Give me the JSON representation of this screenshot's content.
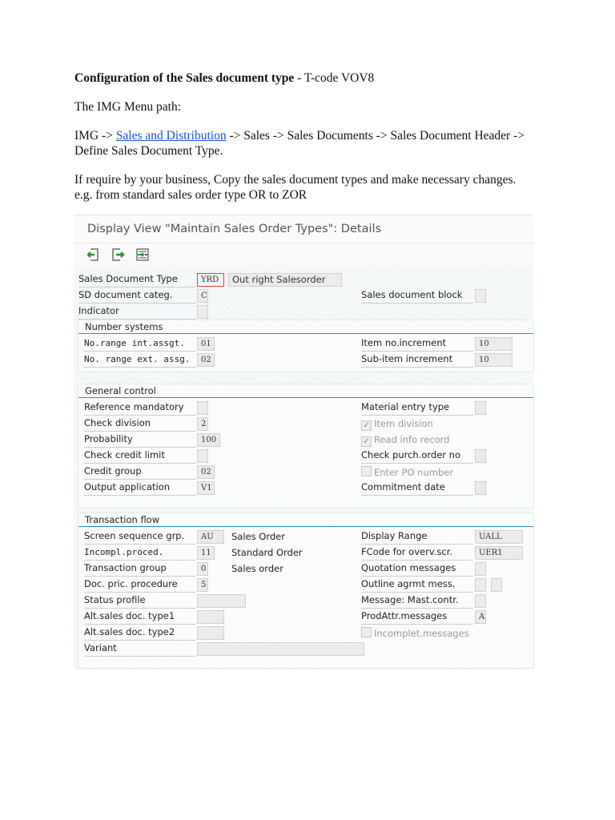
{
  "doc": {
    "heading_bold": "Configuration of the Sales document type",
    "heading_rest": " - T-code VOV8",
    "img_path_label": "The IMG Menu path:",
    "path_prefix": "IMG -> ",
    "path_link": "Sales and Distribution",
    "path_rest": " -> Sales -> Sales Documents -> Sales Document Header -> Define Sales Document Type.",
    "copy_note": "If require by your business, Copy the sales document types and make necessary changes.  e.g. from standard sales order type OR to ZOR"
  },
  "sap": {
    "title": "Display View \"Maintain Sales Order Types\": Details",
    "toolbar": [
      "previous-entry-icon",
      "next-entry-icon",
      "select-block-icon"
    ],
    "sections": [
      {
        "id": "header",
        "title": null,
        "rows": [
          {
            "left": {
              "label": "Sales Document Type",
              "value": "YRD",
              "desc": "Out right Salesorder"
            },
            "right": null
          },
          {
            "left": {
              "label": "SD document categ.",
              "value": "C"
            },
            "right": {
              "label": "Sales document block",
              "value": ""
            }
          },
          {
            "left": {
              "label": "Indicator",
              "value": ""
            },
            "right": null
          }
        ]
      },
      {
        "id": "number-systems",
        "title": "Number systems",
        "rows": [
          {
            "left": {
              "label": "No.range int.assgt.",
              "value": "01",
              "mono": true
            },
            "right": {
              "label": "Item no.increment",
              "value": "10"
            }
          },
          {
            "left": {
              "label": "No. range ext. assg.",
              "value": "02",
              "mono": true
            },
            "right": {
              "label": "Sub-item increment",
              "value": "10"
            }
          }
        ]
      },
      {
        "id": "general-control",
        "title": "General control",
        "rows": [
          {
            "left": {
              "label": "Reference mandatory",
              "value": ""
            },
            "right": {
              "label": "Material entry type",
              "value": ""
            }
          },
          {
            "left": {
              "label": "Check division",
              "value": "2"
            },
            "right": {
              "checkbox": "Item division",
              "checked": true
            }
          },
          {
            "left": {
              "label": "Probability",
              "value": "100"
            },
            "right": {
              "checkbox": "Read info record",
              "checked": true
            }
          },
          {
            "left": {
              "label": "Check credit limit",
              "value": ""
            },
            "right": {
              "label": "Check purch.order no",
              "value": ""
            }
          },
          {
            "left": {
              "label": "Credit group",
              "value": "02"
            },
            "right": {
              "checkbox": "Enter PO number",
              "checked": false
            }
          },
          {
            "left": {
              "label": "Output application",
              "value": "V1"
            },
            "right": {
              "label": "Commitment  date",
              "value": ""
            }
          }
        ]
      },
      {
        "id": "transaction-flow",
        "title": "Transaction flow",
        "rows": [
          {
            "left": {
              "label": "Screen sequence grp.",
              "value": "AU",
              "desc": "Sales Order"
            },
            "right": {
              "label": "Display Range",
              "value": "UALL"
            }
          },
          {
            "left": {
              "label": "Incompl.proced.",
              "value": "11",
              "desc": "Standard Order",
              "mono": true
            },
            "right": {
              "label": "FCode for overv.scr.",
              "value": "UER1"
            }
          },
          {
            "left": {
              "label": "Transaction group",
              "value": "0",
              "desc": "Sales order"
            },
            "right": {
              "label": "Quotation messages",
              "value": ""
            }
          },
          {
            "left": {
              "label": "Doc. pric. procedure",
              "value": "5"
            },
            "right": {
              "label": "Outline agrmt mess.",
              "value": "",
              "extra": true
            }
          },
          {
            "left": {
              "label": "Status profile",
              "value": ""
            },
            "right": {
              "label": "Message: Mast.contr.",
              "value": ""
            }
          },
          {
            "left": {
              "label": "Alt.sales doc. type1",
              "value": ""
            },
            "right": {
              "label": "ProdAttr.messages",
              "value": "A"
            }
          },
          {
            "left": {
              "label": "Alt.sales doc. type2",
              "value": ""
            },
            "right": {
              "checkbox": "Incomplet.messages",
              "checked": false
            }
          },
          {
            "left": {
              "label": "Variant",
              "value": ""
            },
            "right": null
          }
        ]
      }
    ]
  }
}
